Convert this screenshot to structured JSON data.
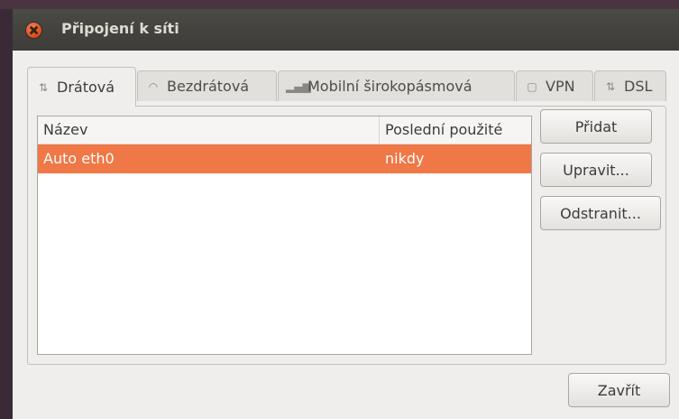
{
  "window": {
    "title": "Připojení k síti"
  },
  "tabs": [
    {
      "label": "Drátová",
      "icon": "wired-icon",
      "active": true
    },
    {
      "label": "Bezdrátová",
      "icon": "wireless-icon",
      "active": false
    },
    {
      "label": "Mobilní širokopásmová",
      "icon": "mobile-signal-icon",
      "active": false
    },
    {
      "label": "VPN",
      "icon": "lock-icon",
      "active": false
    },
    {
      "label": "DSL",
      "icon": "dsl-icon",
      "active": false
    }
  ],
  "list": {
    "columns": [
      "Název",
      "Poslední použité"
    ],
    "rows": [
      {
        "name": "Auto eth0",
        "last_used": "nikdy",
        "selected": true
      }
    ]
  },
  "buttons": {
    "add": "Přidat",
    "edit": "Upravit...",
    "delete": "Odstranit...",
    "close": "Zavřít"
  },
  "colors": {
    "selection": "#f07746",
    "titlebar": "#3d3c38",
    "close_button": "#dd4814"
  }
}
